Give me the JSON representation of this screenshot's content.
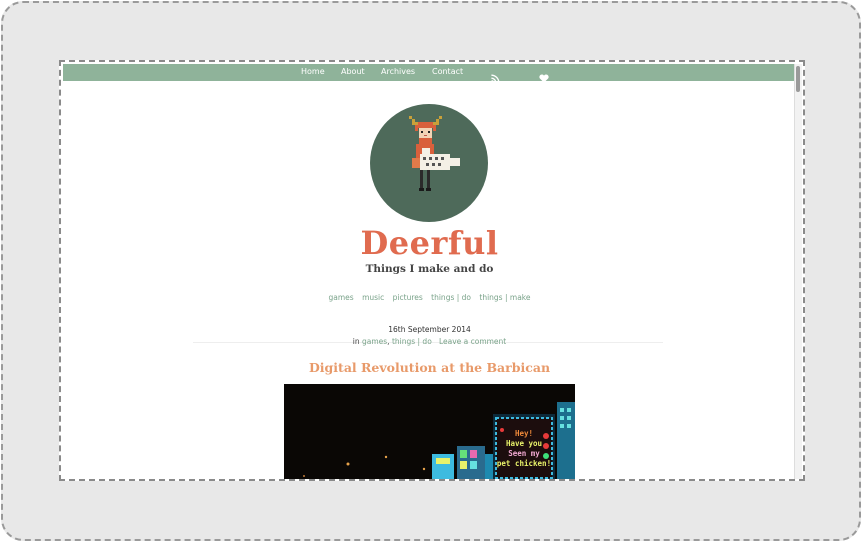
{
  "nav": {
    "items": [
      "Home",
      "About",
      "Archives",
      "Contact"
    ],
    "icons": [
      "rss-icon",
      "heart-icon"
    ]
  },
  "site": {
    "title": "Deerful",
    "tagline": "Things I make and do"
  },
  "categories": [
    "games",
    "music",
    "pictures",
    "things | do",
    "things | make"
  ],
  "post": {
    "date": "16th September 2014",
    "meta_prefix": "in",
    "meta_categories": [
      "games",
      "things | do"
    ],
    "comment_link": "Leave a comment",
    "title": "Digital Revolution at the Barbican",
    "sign_lines": [
      "Hey!",
      "Have you",
      "Seen my",
      "pet chicken!"
    ]
  },
  "colors": {
    "nav_bg": "#8fb39a",
    "title": "#e06b4f",
    "post_title": "#e89a6a",
    "link": "#7aa38a",
    "avatar_bg": "#4e6a5a"
  }
}
